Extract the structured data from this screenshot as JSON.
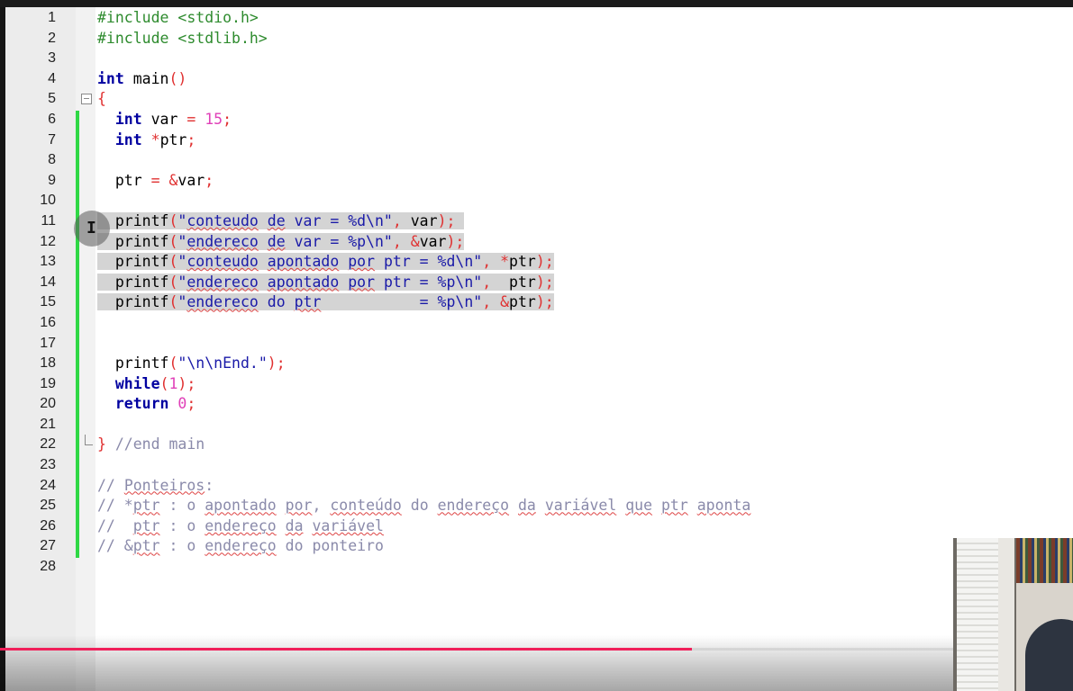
{
  "editor": {
    "lines": [
      {
        "n": "1",
        "seg": [
          {
            "t": "#include <stdio.h>",
            "c": "pp"
          }
        ]
      },
      {
        "n": "2",
        "seg": [
          {
            "t": "#include <stdlib.h>",
            "c": "pp"
          }
        ]
      },
      {
        "n": "3",
        "seg": []
      },
      {
        "n": "4",
        "seg": [
          {
            "t": "int",
            "c": "kw"
          },
          {
            "t": " main"
          },
          {
            "t": "()",
            "c": "op"
          }
        ]
      },
      {
        "n": "5",
        "fold": "start",
        "seg": [
          {
            "t": "{",
            "c": "op"
          }
        ]
      },
      {
        "n": "6",
        "seg": [
          {
            "t": "  "
          },
          {
            "t": "int",
            "c": "kw"
          },
          {
            "t": " var "
          },
          {
            "t": "=",
            "c": "op"
          },
          {
            "t": " "
          },
          {
            "t": "15",
            "c": "num"
          },
          {
            "t": ";",
            "c": "op"
          }
        ]
      },
      {
        "n": "7",
        "seg": [
          {
            "t": "  "
          },
          {
            "t": "int",
            "c": "kw"
          },
          {
            "t": " "
          },
          {
            "t": "*",
            "c": "op"
          },
          {
            "t": "ptr"
          },
          {
            "t": ";",
            "c": "op"
          }
        ]
      },
      {
        "n": "8",
        "seg": []
      },
      {
        "n": "9",
        "seg": [
          {
            "t": "  ptr "
          },
          {
            "t": "=",
            "c": "op"
          },
          {
            "t": " "
          },
          {
            "t": "&",
            "c": "op"
          },
          {
            "t": "var"
          },
          {
            "t": ";",
            "c": "op"
          }
        ]
      },
      {
        "n": "10",
        "seg": []
      },
      {
        "n": "11",
        "hl": true,
        "seg": [
          {
            "t": "  printf"
          },
          {
            "t": "(",
            "c": "op"
          },
          {
            "t": "\"",
            "c": "str"
          },
          {
            "t": "conteudo",
            "c": "str sq"
          },
          {
            "t": " ",
            "c": "str"
          },
          {
            "t": "de",
            "c": "str sq"
          },
          {
            "t": " var = %d\\n\"",
            "c": "str"
          },
          {
            "t": ",",
            "c": "op"
          },
          {
            "t": " var"
          },
          {
            "t": ");",
            "c": "op"
          },
          {
            "t": " "
          }
        ]
      },
      {
        "n": "12",
        "hl": true,
        "seg": [
          {
            "t": "  printf"
          },
          {
            "t": "(",
            "c": "op"
          },
          {
            "t": "\"",
            "c": "str"
          },
          {
            "t": "endereco",
            "c": "str sq"
          },
          {
            "t": " ",
            "c": "str"
          },
          {
            "t": "de",
            "c": "str sq"
          },
          {
            "t": " var = %p\\n\"",
            "c": "str"
          },
          {
            "t": ",",
            "c": "op"
          },
          {
            "t": " "
          },
          {
            "t": "&",
            "c": "op"
          },
          {
            "t": "var"
          },
          {
            "t": ");",
            "c": "op"
          }
        ]
      },
      {
        "n": "13",
        "hl": true,
        "seg": [
          {
            "t": "  printf"
          },
          {
            "t": "(",
            "c": "op"
          },
          {
            "t": "\"",
            "c": "str"
          },
          {
            "t": "conteudo",
            "c": "str sq"
          },
          {
            "t": " ",
            "c": "str"
          },
          {
            "t": "apontado",
            "c": "str sq"
          },
          {
            "t": " ",
            "c": "str"
          },
          {
            "t": "por",
            "c": "str sq"
          },
          {
            "t": " ptr = %d\\n\"",
            "c": "str"
          },
          {
            "t": ",",
            "c": "op"
          },
          {
            "t": " "
          },
          {
            "t": "*",
            "c": "op"
          },
          {
            "t": "ptr"
          },
          {
            "t": ");",
            "c": "op"
          }
        ]
      },
      {
        "n": "14",
        "hl": true,
        "seg": [
          {
            "t": "  printf"
          },
          {
            "t": "(",
            "c": "op"
          },
          {
            "t": "\"",
            "c": "str"
          },
          {
            "t": "endereco",
            "c": "str sq"
          },
          {
            "t": " ",
            "c": "str"
          },
          {
            "t": "apontado",
            "c": "str sq"
          },
          {
            "t": " ",
            "c": "str"
          },
          {
            "t": "por",
            "c": "str sq"
          },
          {
            "t": " ptr = %p\\n\"",
            "c": "str"
          },
          {
            "t": ",",
            "c": "op"
          },
          {
            "t": "  ptr"
          },
          {
            "t": ");",
            "c": "op"
          }
        ]
      },
      {
        "n": "15",
        "hl": true,
        "seg": [
          {
            "t": "  printf"
          },
          {
            "t": "(",
            "c": "op"
          },
          {
            "t": "\"",
            "c": "str"
          },
          {
            "t": "endereco",
            "c": "str sq"
          },
          {
            "t": " do ",
            "c": "str"
          },
          {
            "t": "ptr",
            "c": "str sq"
          },
          {
            "t": "           = %p\\n\"",
            "c": "str"
          },
          {
            "t": ",",
            "c": "op"
          },
          {
            "t": " "
          },
          {
            "t": "&",
            "c": "op"
          },
          {
            "t": "ptr"
          },
          {
            "t": ");",
            "c": "op"
          }
        ]
      },
      {
        "n": "16",
        "seg": []
      },
      {
        "n": "17",
        "seg": []
      },
      {
        "n": "18",
        "seg": [
          {
            "t": "  printf"
          },
          {
            "t": "(",
            "c": "op"
          },
          {
            "t": "\"\\n\\nEnd.\"",
            "c": "str"
          },
          {
            "t": ");",
            "c": "op"
          }
        ]
      },
      {
        "n": "19",
        "seg": [
          {
            "t": "  "
          },
          {
            "t": "while",
            "c": "kw"
          },
          {
            "t": "(",
            "c": "op"
          },
          {
            "t": "1",
            "c": "num"
          },
          {
            "t": ");",
            "c": "op"
          }
        ]
      },
      {
        "n": "20",
        "seg": [
          {
            "t": "  "
          },
          {
            "t": "return",
            "c": "kw"
          },
          {
            "t": " "
          },
          {
            "t": "0",
            "c": "num"
          },
          {
            "t": ";",
            "c": "op"
          }
        ]
      },
      {
        "n": "21",
        "seg": []
      },
      {
        "n": "22",
        "fold": "end",
        "seg": [
          {
            "t": "}",
            "c": "op"
          },
          {
            "t": " //end main",
            "c": "cm"
          }
        ]
      },
      {
        "n": "23",
        "seg": []
      },
      {
        "n": "24",
        "seg": [
          {
            "t": "// ",
            "c": "cm"
          },
          {
            "t": "Ponteiros",
            "c": "cm sq"
          },
          {
            "t": ":",
            "c": "cm"
          }
        ]
      },
      {
        "n": "25",
        "seg": [
          {
            "t": "// *",
            "c": "cm"
          },
          {
            "t": "ptr",
            "c": "cm sq"
          },
          {
            "t": " : o ",
            "c": "cm"
          },
          {
            "t": "apontado",
            "c": "cm sq"
          },
          {
            "t": " ",
            "c": "cm"
          },
          {
            "t": "por",
            "c": "cm sq"
          },
          {
            "t": ", ",
            "c": "cm"
          },
          {
            "t": "conteúdo",
            "c": "cm sq"
          },
          {
            "t": " do ",
            "c": "cm"
          },
          {
            "t": "endereço",
            "c": "cm sq"
          },
          {
            "t": " ",
            "c": "cm"
          },
          {
            "t": "da",
            "c": "cm sq"
          },
          {
            "t": " ",
            "c": "cm"
          },
          {
            "t": "variável",
            "c": "cm sq"
          },
          {
            "t": " ",
            "c": "cm"
          },
          {
            "t": "que",
            "c": "cm sq"
          },
          {
            "t": " ",
            "c": "cm"
          },
          {
            "t": "ptr",
            "c": "cm sq"
          },
          {
            "t": " ",
            "c": "cm"
          },
          {
            "t": "aponta",
            "c": "cm sq"
          }
        ]
      },
      {
        "n": "26",
        "seg": [
          {
            "t": "//  ",
            "c": "cm"
          },
          {
            "t": "ptr",
            "c": "cm sq"
          },
          {
            "t": " : o ",
            "c": "cm"
          },
          {
            "t": "endereço",
            "c": "cm sq"
          },
          {
            "t": " ",
            "c": "cm"
          },
          {
            "t": "da",
            "c": "cm sq"
          },
          {
            "t": " ",
            "c": "cm"
          },
          {
            "t": "variável",
            "c": "cm sq"
          }
        ]
      },
      {
        "n": "27",
        "seg": [
          {
            "t": "// &",
            "c": "cm"
          },
          {
            "t": "ptr",
            "c": "cm sq"
          },
          {
            "t": " : o ",
            "c": "cm"
          },
          {
            "t": "endereço",
            "c": "cm sq"
          },
          {
            "t": " do ponteiro",
            "c": "cm"
          }
        ]
      },
      {
        "n": "28",
        "seg": []
      }
    ]
  },
  "video": {
    "progress": 0.645,
    "progress_color": "#f0205a"
  },
  "colors": {
    "keyword": "#0000a0",
    "preprocessor": "#2e8b2e",
    "string": "#1a1aa8",
    "number": "#e040b8",
    "operator": "#e03030",
    "comment": "#8a8aaa",
    "selection": "#d4d4d4",
    "change_bar": "#2fd845"
  }
}
